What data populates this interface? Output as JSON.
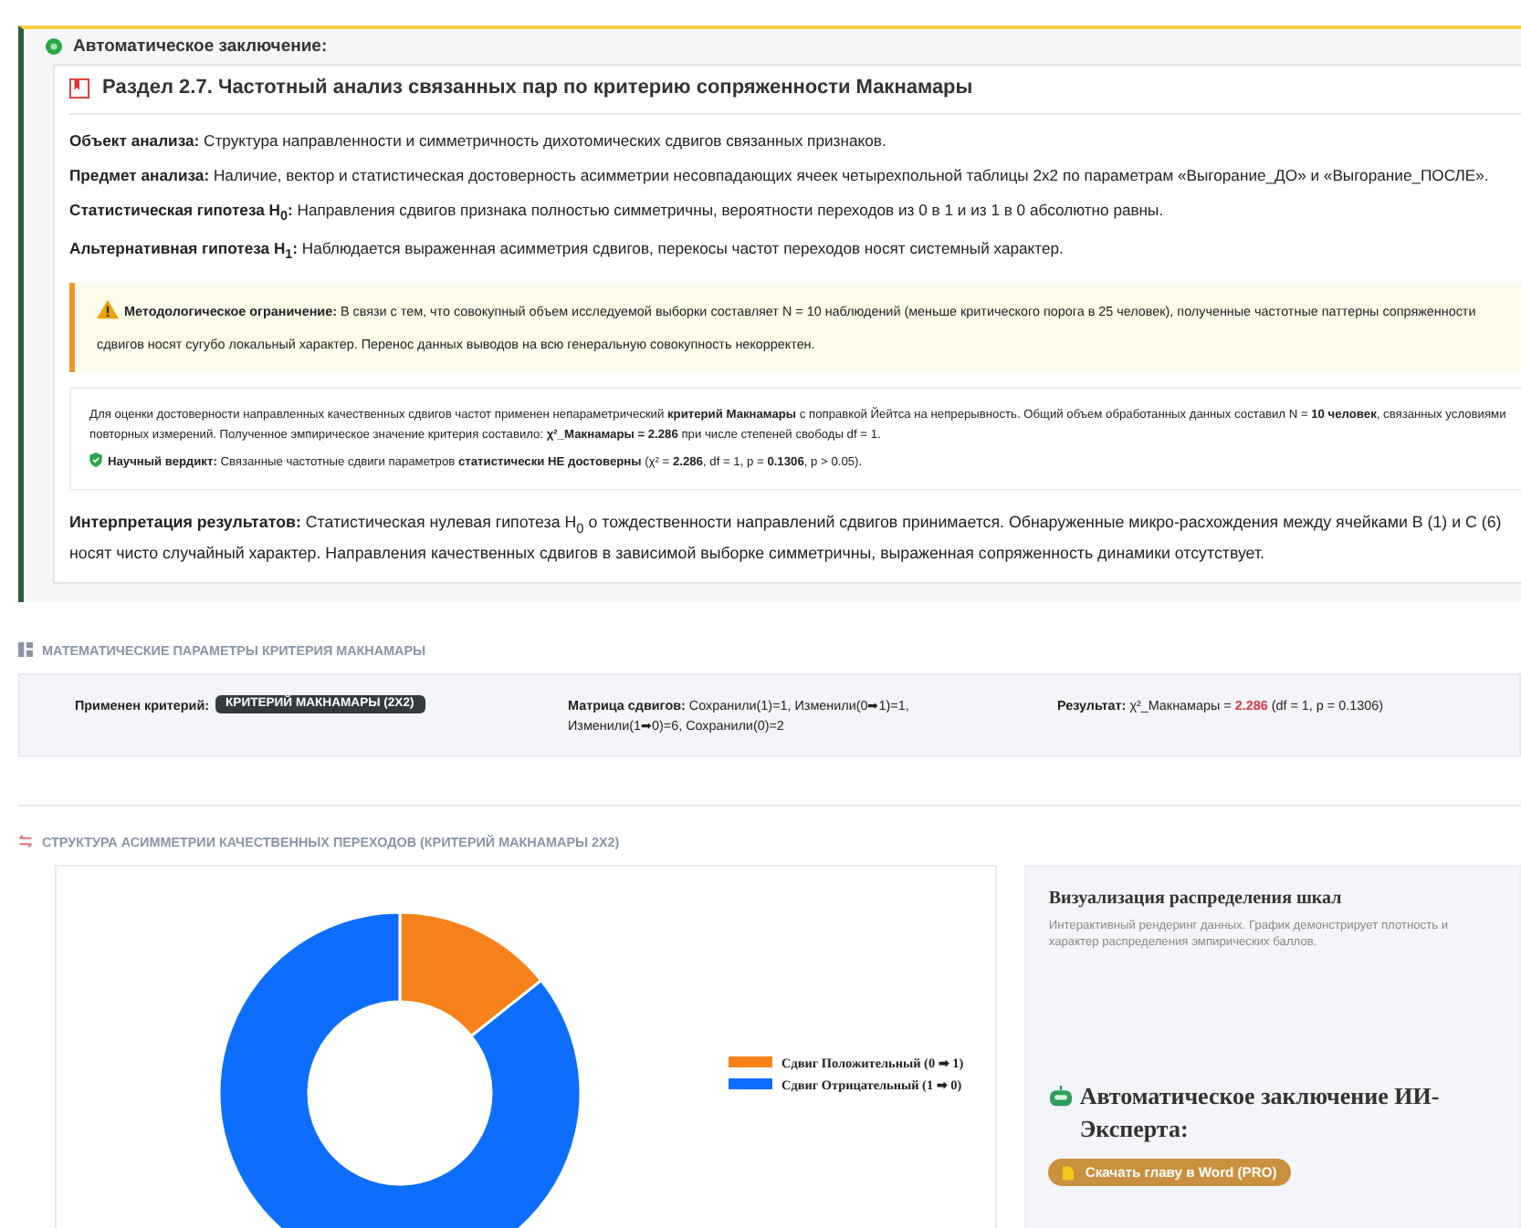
{
  "conclusion": {
    "title": "Автоматическое заключение:",
    "section_title": "Раздел 2.7. Частотный анализ связанных пар по критерию сопряженности Макнамары",
    "paragraphs": [
      {
        "label": "Объект анализа:",
        "text": "Структура направленности и симметричность дихотомических сдвигов связанных признаков."
      },
      {
        "label": "Предмет анализа:",
        "text": "Наличие, вектор и статистическая достоверность асимметрии несовпадающих ячеек четырехпольной таблицы 2x2 по параметрам «Выгорание_ДО» и «Выгорание_ПОСЛЕ»."
      },
      {
        "label": "Статистическая гипотеза H$_{0}$:",
        "text": "Направления сдвигов признака полностью симметричны, вероятности переходов из 0 в 1 и из 1 в 0 абсолютно равны."
      },
      {
        "label": "Альтернативная гипотеза H$_{1}$:",
        "text": "Наблюдается выраженная асимметрия сдвигов, перекосы частот переходов носят системный характер."
      }
    ],
    "warning": {
      "label": "Методологическое ограничение:",
      "text": "В связи с тем, что совокупный объем исследуемой выборки составляет N = 10 наблюдений (меньше критического порога в 25 человек), полученные частотные паттерны сопряженности сдвигов носят сугубо локальный характер. Перенос данных выводов на всю генеральную совокупность некорректен."
    },
    "method_note": "Для оценки достоверности направленных качественных сдвигов частот применен непараметрический **критерий Макнамары** с поправкой Йейтса на непрерывность. Общий объем обработанных данных составил N = **10 человек**, связанных условиями повторных измерений. Полученное эмпирическое значение критерия составило: **χ²_Макнамары = 2.286** при числе степеней свободы df = 1.",
    "verdict": {
      "label": "Научный вердикт:",
      "text": "Связанные частотные сдвиги параметров **статистически НЕ достоверны** (χ² = **2.286**, df = 1, p = **0.1306**, p > 0.05)."
    },
    "interpretation": {
      "label": "Интерпретация результатов:",
      "text": "Статистическая нулевая гипотеза H$_{0}$ о тождественности направлений сдвигов принимается. Обнаруженные микро-расхождения между ячейками B (1) и С (6) носят чисто случайный характер. Направления качественных сдвигов в зависимой выборке симметричны, выраженная сопряженность динамики отсутствует."
    }
  },
  "parameters": {
    "title": "МАТЕМАТИЧЕСКИЕ ПАРАМЕТРЫ КРИТЕРИЯ МАКНАМАРЫ",
    "criterion_label": "Применен критерий:",
    "criterion_badge": "КРИТЕРИЙ МАКНАМАРЫ (2X2)",
    "matrix_label": "Матрица сдвигов:",
    "matrix_text": "Сохранили(1)=1, Изменили(0➡1)=1, Изменили(1➡0)=6, Сохранили(0)=2",
    "result_label": "Результат:",
    "result_prefix": "χ²_Макнамары =",
    "result_value": "2.286",
    "result_suffix": "(df = 1, p = 0.1306)"
  },
  "chart_section": {
    "title": "СТРУКТУРА АСИММЕТРИИ КАЧЕСТВЕННЫХ ПЕРЕХОДОВ (КРИТЕРИЙ МАКНАМАРЫ 2X2)",
    "chart_data": {
      "type": "donut",
      "categories": [
        "Сдвиг Положительный (0 ➡ 1)",
        "Сдвиг Отрицательный (1 ➡ 0)"
      ],
      "values": [
        1,
        6
      ],
      "legend": "right",
      "colors": [
        "#f7821b",
        "#0d6efd"
      ]
    }
  },
  "side_panel": {
    "title": "Визуализация распределения шкал",
    "description": "Интерактивный рендеринг данных. График демонстрирует плотность и характер распределения эмпирических баллов.",
    "ai_title": "Автоматическое заключение ИИ-Эксперта:",
    "download_button": "Скачать главу в Word (PRO)"
  }
}
